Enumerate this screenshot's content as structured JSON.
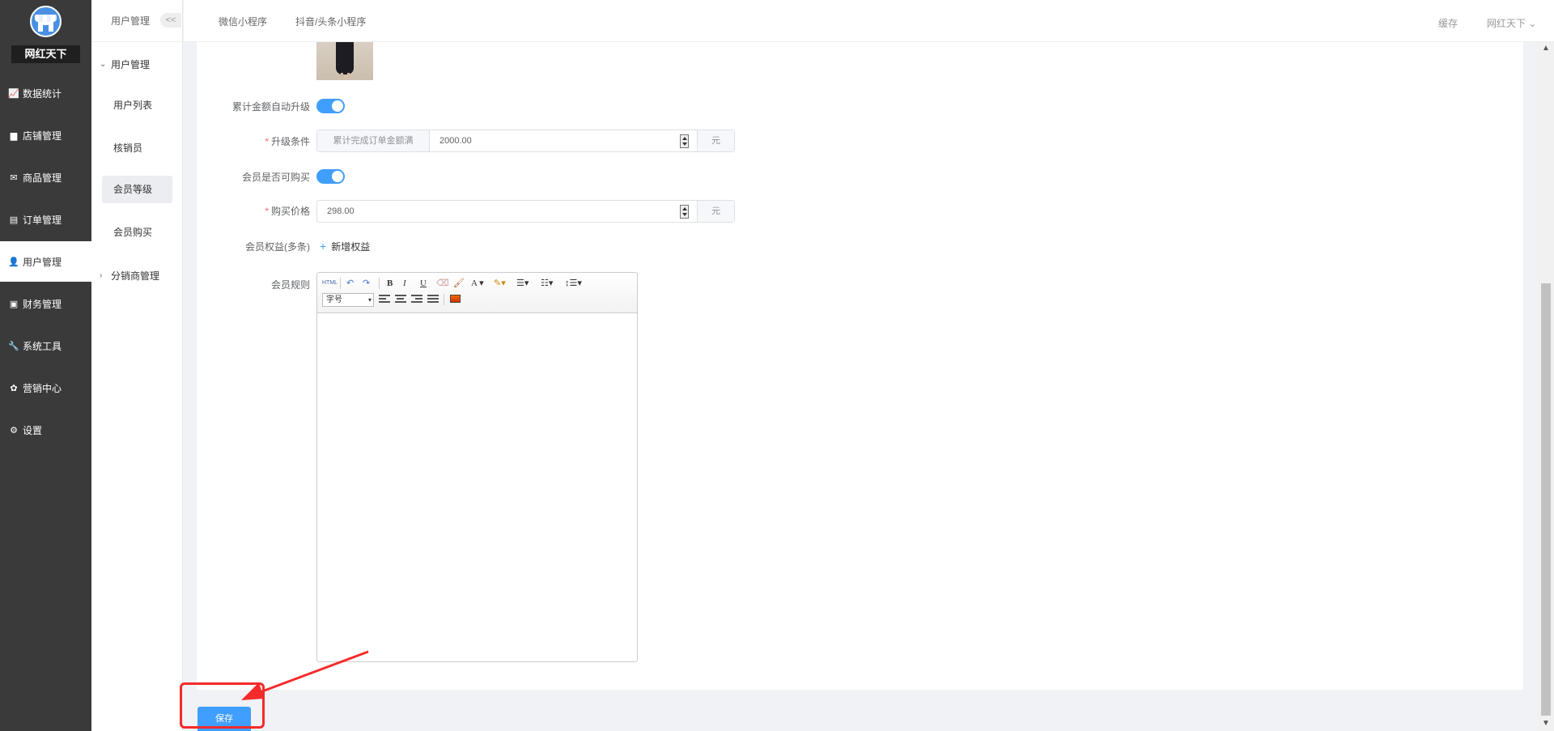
{
  "brand": {
    "shop_name": "网红天下"
  },
  "nav": [
    {
      "label": "数据统计",
      "icon": "chart-line-icon"
    },
    {
      "label": "店铺管理",
      "icon": "shop-icon"
    },
    {
      "label": "商品管理",
      "icon": "goods-icon"
    },
    {
      "label": "订单管理",
      "icon": "order-icon"
    },
    {
      "label": "用户管理",
      "icon": "user-icon",
      "active": true
    },
    {
      "label": "财务管理",
      "icon": "finance-icon"
    },
    {
      "label": "系统工具",
      "icon": "wrench-icon"
    },
    {
      "label": "营销中心",
      "icon": "marketing-icon"
    },
    {
      "label": "设置",
      "icon": "gear-icon"
    }
  ],
  "subnav": {
    "header": "用户管理",
    "collapse": "<<",
    "group1": "用户管理",
    "items": [
      "用户列表",
      "核销员",
      "会员等级",
      "会员购买"
    ],
    "group2": "分销商管理"
  },
  "topbar": {
    "tabs": [
      "微信小程序",
      "抖音/头条小程序"
    ],
    "cache": "缓存",
    "user": "网红天下"
  },
  "form": {
    "auto_upgrade_label": "累计金额自动升级",
    "upgrade_cond_label": "升级条件",
    "upgrade_prefix": "累计完成订单金额满",
    "upgrade_value": "2000.00",
    "unit": "元",
    "can_buy_label": "会员是否可购买",
    "price_label": "购买价格",
    "price_value": "298.00",
    "rights_label": "会员权益(多条)",
    "add_rights": "新增权益",
    "rules_label": "会员规则",
    "font_size_select": "字号"
  },
  "save_label": "保存",
  "colors": {
    "primary": "#409eff",
    "sidebar": "#3a3a3a",
    "highlight": "#f52b2b"
  }
}
